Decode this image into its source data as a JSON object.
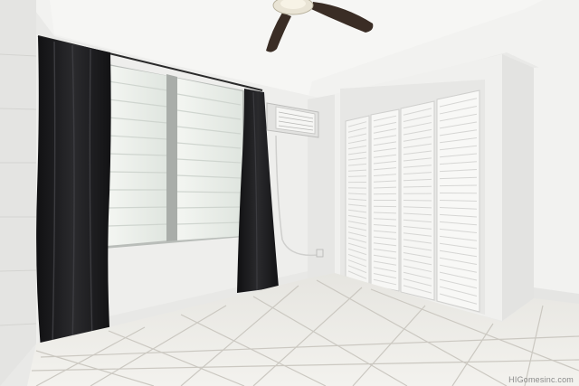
{
  "scene": {
    "type": "photo",
    "watermark": "HIGomesinc.com"
  },
  "colors": {
    "ceiling": "#f1f1ef",
    "wall_light": "#efefed",
    "wall_shadow": "#dcdcda",
    "floor_tile": "#efeeea",
    "grout": "#c9c6bf",
    "curtain": "#1c1c1e",
    "closet_door": "#f4f4f2",
    "window_glass": "#e3e8e2",
    "fan_blade": "#3b2f28"
  },
  "icons": [
    "ceiling-fan-icon",
    "air-conditioner-icon",
    "power-outlet-icon"
  ]
}
